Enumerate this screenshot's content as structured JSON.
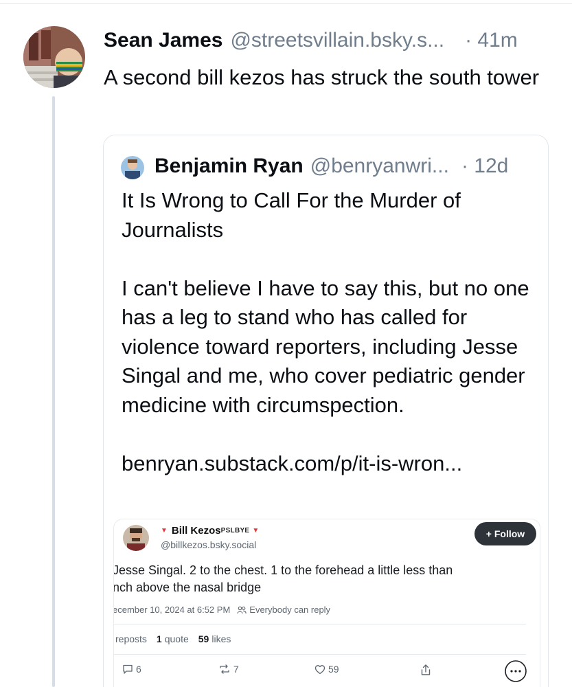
{
  "post": {
    "author_name": "Sean James",
    "author_handle": "@streetsvillain.bsky.s...",
    "time": "· 41m",
    "text": "A second bill kezos has struck the south tower"
  },
  "quote": {
    "author_name": "Benjamin Ryan",
    "author_handle": "@benryanwri...",
    "time": "· 12d",
    "text": "It Is Wrong to Call For the Murder of Journalists\n\nI can't believe I have to say this, but no one has a leg to stand who has called for violence toward reporters, including Jesse Singal and me, who cover pediatric gender medicine with circumspection.\n\nbenryan.substack.com/p/it-is-wron..."
  },
  "embed": {
    "author_name": "Bill Kezos",
    "author_tag": "PSLBYE",
    "author_handle": "@billkezos.bsky.social",
    "follow_label": "+ Follow",
    "text_line1": "Jesse Singal. 2 to the chest. 1 to the forehead a little less than",
    "text_line2": "nch above the nasal bridge",
    "date": "ecember 10, 2024 at 6:52 PM",
    "reply_setting": "Everybody can reply",
    "reposts_count": "",
    "reposts_label": "reposts",
    "quote_count": "1",
    "quote_label": "quote",
    "likes_count": "59",
    "likes_label": "likes",
    "actions": {
      "reply_count": "6",
      "repost_count": "7",
      "like_count": "59"
    }
  },
  "icons": [
    "chat-bubble-icon",
    "repost-icon",
    "heart-icon",
    "share-icon",
    "more-icon",
    "people-icon",
    "red-triangle-icon"
  ],
  "colors": {
    "text": "#0b0f14",
    "muted": "#6f7d8c",
    "thread_line": "#d7dde4",
    "follow_bg": "#2d3339",
    "flag_red": "#e0393e"
  }
}
